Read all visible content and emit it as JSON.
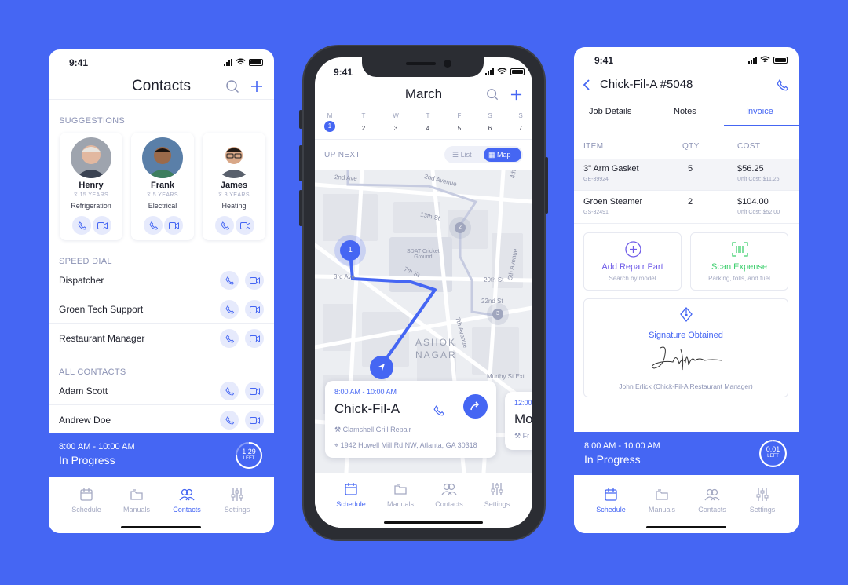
{
  "colors": {
    "accent": "#4566f3",
    "background": "#4566f3",
    "scan_green": "#3ecf6e",
    "muted": "#8c93b5"
  },
  "contacts_screen": {
    "status_time": "9:41",
    "title": "Contacts",
    "suggestions_label": "SUGGESTIONS",
    "suggestions": [
      {
        "name": "Henry",
        "years": "15 YEARS",
        "role": "Refrigeration"
      },
      {
        "name": "Frank",
        "years": "5 YEARS",
        "role": "Electrical"
      },
      {
        "name": "James",
        "years": "3 YEARS",
        "role": "Heating"
      }
    ],
    "speed_dial_label": "SPEED DIAL",
    "speed_dial": [
      "Dispatcher",
      "Groen Tech Support",
      "Restaurant Manager"
    ],
    "all_contacts_label": "ALL CONTACTS",
    "all_contacts": [
      "Adam Scott",
      "Andrew Doe"
    ],
    "progress": {
      "time": "8:00 AM - 10:00 AM",
      "status": "In Progress",
      "timer": "1:29",
      "timer_label": "LEFT",
      "fraction": 0.75
    },
    "tabs": [
      "Schedule",
      "Manuals",
      "Contacts",
      "Settings"
    ],
    "active_tab": "Contacts"
  },
  "schedule_screen": {
    "status_time": "9:41",
    "title": "March",
    "days": [
      {
        "letter": "M",
        "num": "1"
      },
      {
        "letter": "T",
        "num": "2"
      },
      {
        "letter": "W",
        "num": "3"
      },
      {
        "letter": "T",
        "num": "4"
      },
      {
        "letter": "F",
        "num": "5"
      },
      {
        "letter": "S",
        "num": "6"
      },
      {
        "letter": "S",
        "num": "7"
      }
    ],
    "up_next_label": "UP NEXT",
    "view_list": "List",
    "view_map": "Map",
    "map_labels": {
      "s2nd_ave": "2nd Ave",
      "s2nd_avenue": "2nd Avenue",
      "s13th": "13th St",
      "s4th": "4th",
      "sdat": "SDAT Cricket",
      "ground": "Ground",
      "s3rd": "3rd Ave",
      "s7th": "7th St",
      "s20th": "20th St",
      "s5th": "5th Avenue",
      "s22nd": "22nd St",
      "ashok": "ASHOK",
      "nagar": "NAGAR",
      "s7th_ave": "7th Avenue",
      "murthy": "Murthy St Ext",
      "stop1": "1",
      "stop2": "2",
      "stop3": "3"
    },
    "job_card": {
      "time": "8:00 AM - 10:00 AM",
      "title": "Chick-Fil-A",
      "task": "Clamshell Grill Repair",
      "address": "1942 Howell Mill Rd NW, Atlanta, GA 30318"
    },
    "next_card": {
      "time": "12:00",
      "title": "Mo",
      "task": "Fr"
    },
    "tabs": [
      "Schedule",
      "Manuals",
      "Contacts",
      "Settings"
    ],
    "active_tab": "Schedule"
  },
  "invoice_screen": {
    "status_time": "9:41",
    "title": "Chick-Fil-A #5048",
    "tabs": [
      "Job Details",
      "Notes",
      "Invoice"
    ],
    "active_tab": "Invoice",
    "columns": {
      "item": "ITEM",
      "qty": "QTY",
      "cost": "COST"
    },
    "items": [
      {
        "name": "3\" Arm Gasket",
        "sku": "GE-39924",
        "qty": "5",
        "cost": "$56.25",
        "unit": "Unit Cost: $11.25"
      },
      {
        "name": "Groen Steamer",
        "sku": "GS-32491",
        "qty": "2",
        "cost": "$104.00",
        "unit": "Unit Cost: $52.00"
      }
    ],
    "add_repair": {
      "label": "Add Repair Part",
      "sub": "Search by model"
    },
    "scan_expense": {
      "label": "Scan Expense",
      "sub": "Parking, tolls, and fuel"
    },
    "signature": {
      "label": "Signature Obtained",
      "signer": "John Erlick (Chick-Fil-A Restaurant Manager)"
    },
    "progress": {
      "time": "8:00 AM - 10:00 AM",
      "status": "In Progress",
      "timer": "0:01",
      "timer_label": "LEFT",
      "fraction": 0.99
    },
    "bottom_tabs": [
      "Schedule",
      "Manuals",
      "Contacts",
      "Settings"
    ],
    "active_bottom_tab": "Schedule"
  }
}
